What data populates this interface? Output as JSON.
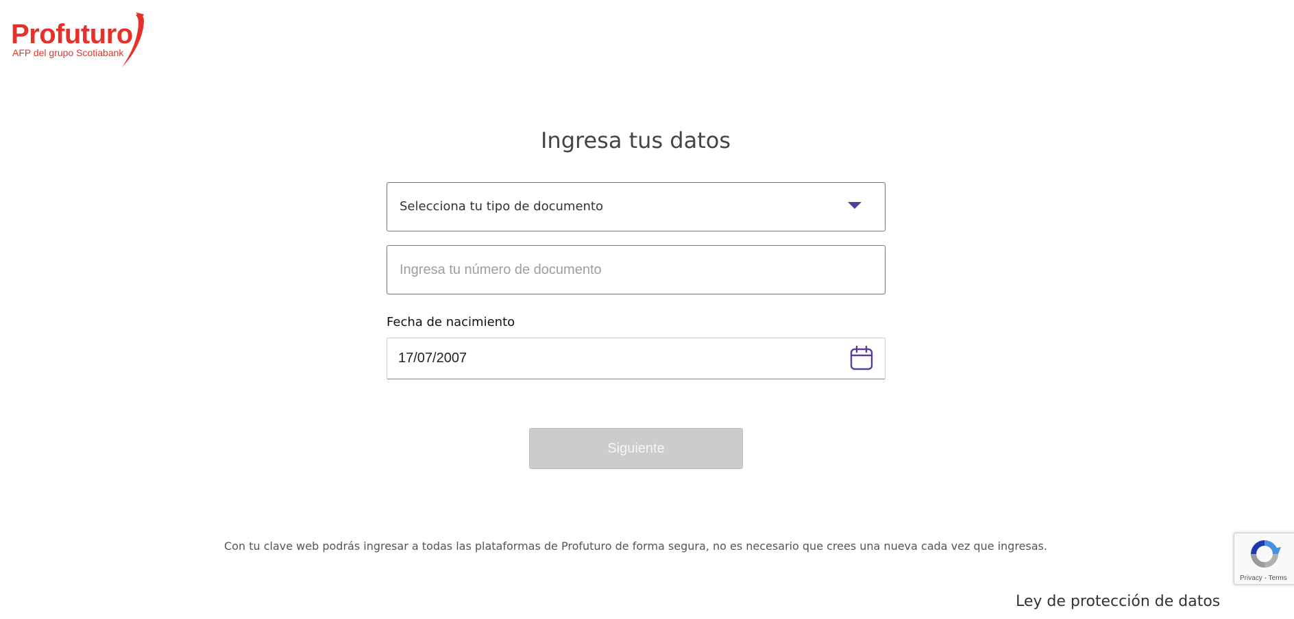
{
  "brand": {
    "name": "Profuturo",
    "tagline": "AFP del grupo Scotiabank",
    "color": "#e8302a"
  },
  "form": {
    "title": "Ingresa tus datos",
    "document_type": {
      "selected": "Selecciona tu tipo de documento"
    },
    "document_number": {
      "placeholder": "Ingresa tu número de documento",
      "value": ""
    },
    "birth_date": {
      "label": "Fecha de nacimiento",
      "value": "17/07/2007"
    },
    "next_label": "Siguiente"
  },
  "info_text": "Con tu clave web podrás ingresar a todas las plataformas de Profuturo de forma segura, no es necesario que crees una nueva cada vez que ingresas.",
  "footer": {
    "data_protection_link": "Ley de protección de datos"
  },
  "recaptcha": {
    "privacy": "Privacy",
    "separator": "-",
    "terms": "Terms"
  },
  "colors": {
    "accent": "#5a3e96",
    "disabled_button": "#cccccc"
  },
  "icons": {
    "dropdown": "chevron-down-icon",
    "date": "calendar-icon",
    "captcha": "recaptcha-icon"
  }
}
